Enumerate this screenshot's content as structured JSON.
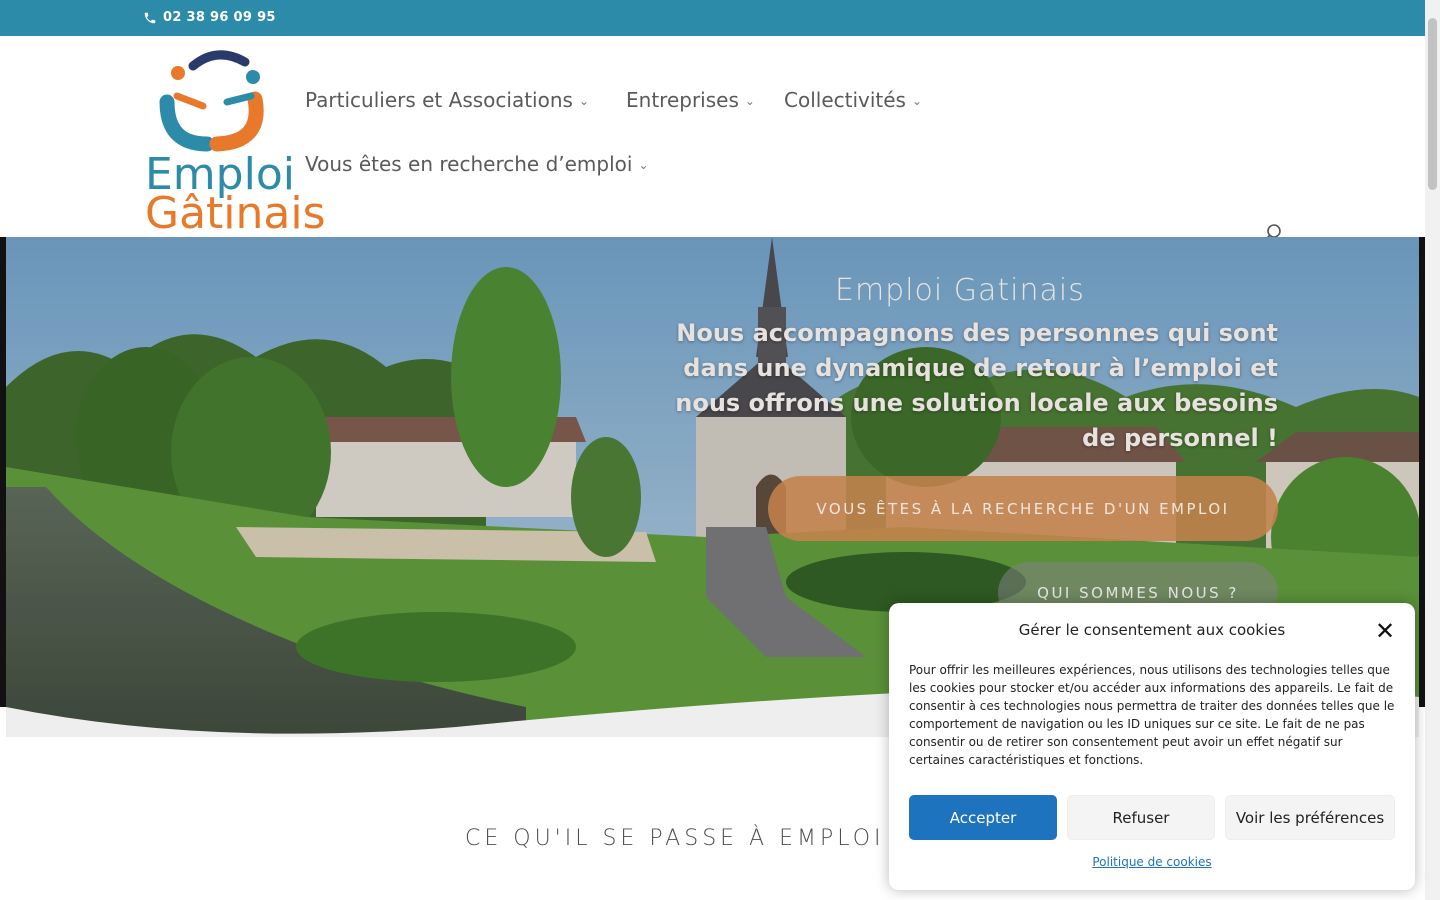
{
  "topbar": {
    "phone": "02 38 96 09 95",
    "background": "#2b8ba8"
  },
  "logo": {
    "line1": "Emploi",
    "line2": "Gâtinais"
  },
  "nav": {
    "items": [
      {
        "label": "Particuliers et Associations"
      },
      {
        "label": "Entreprises"
      },
      {
        "label": "Collectivités"
      },
      {
        "label": "Vous êtes en recherche d’emploi"
      }
    ]
  },
  "hero": {
    "title": "Emploi Gatinais",
    "text": "Nous accompagnons des personnes qui sont dans une dynamique de retour à l’emploi et nous offrons une solution locale aux besoins de personnel !",
    "cta_primary": "VOUS ÊTES À LA RECHERCHE D'UN EMPLOI",
    "cta_secondary": "QUI SOMMES NOUS ?"
  },
  "section": {
    "title": "CE QU'IL SE PASSE À EMPLOI GAT"
  },
  "cookie": {
    "title": "Gérer le consentement aux cookies",
    "text": "Pour offrir les meilleures expériences, nous utilisons des technologies telles que les cookies pour stocker et/ou accéder aux informations des appareils. Le fait de consentir à ces technologies nous permettra de traiter des données telles que le comportement de navigation ou les ID uniques sur ce site. Le fait de ne pas consentir ou de retirer son consentement peut avoir un effet négatif sur certaines caractéristiques et fonctions.",
    "accept": "Accepter",
    "refuse": "Refuser",
    "preferences": "Voir les préférences",
    "policy": "Politique de cookies",
    "close": "✕"
  },
  "colors": {
    "accent_blue": "#1e73be",
    "brand_orange": "#e8792b",
    "brand_teal": "#2b8ba8",
    "brand_navy": "#2a3a6b"
  }
}
